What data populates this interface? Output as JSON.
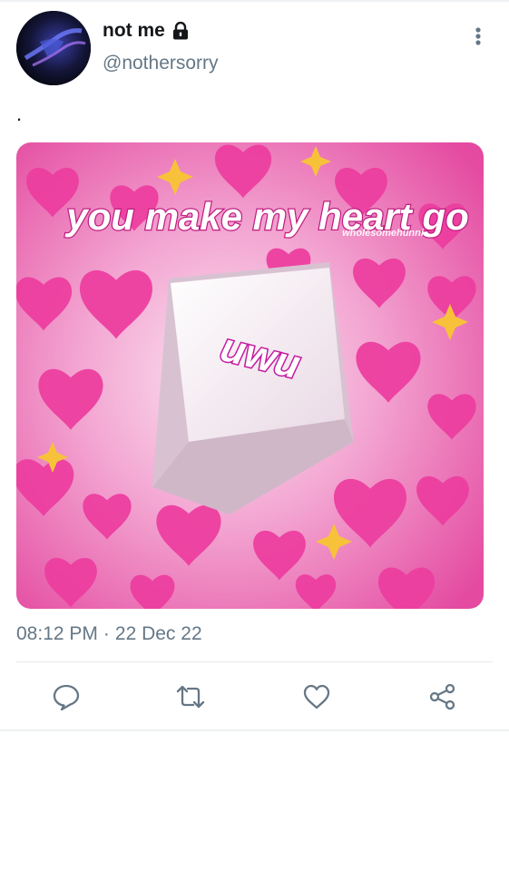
{
  "tweet": {
    "author": {
      "display_name": "not me",
      "handle": "@nothersorry",
      "protected_icon": "lock-icon",
      "avatar_icon": "avatar-image"
    },
    "more_icon": "more-vertical-icon",
    "text": ".",
    "media": {
      "headline": "you make my heart go",
      "watermark": "wholesomehunni",
      "key_label": "uwu",
      "accent_color": "#e8409e"
    },
    "time": "08:12 PM",
    "separator": "·",
    "date": "22 Dec 22",
    "actions": [
      {
        "name": "reply",
        "icon": "reply-icon"
      },
      {
        "name": "retweet",
        "icon": "retweet-icon"
      },
      {
        "name": "like",
        "icon": "heart-icon"
      },
      {
        "name": "share",
        "icon": "share-icon"
      }
    ],
    "icon_color": "#657786"
  }
}
